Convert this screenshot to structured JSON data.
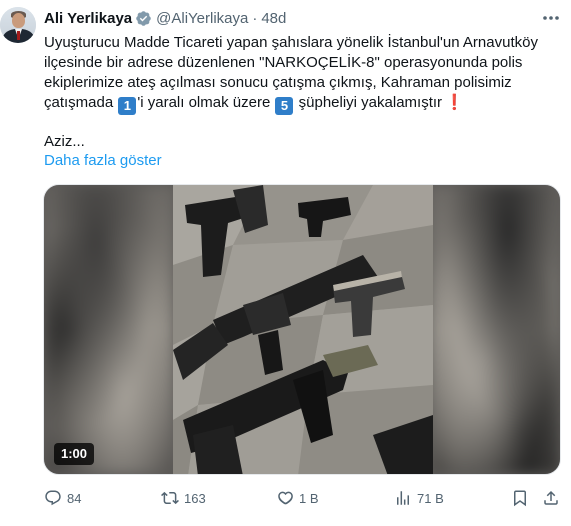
{
  "tweet": {
    "author": {
      "name": "Ali Yerlikaya",
      "handle": "@AliYerlikaya",
      "verified_badge_color": "#829aab"
    },
    "separator": "·",
    "time": "48d",
    "text_lines": {
      "l1": "Uyuşturucu Madde Ticareti yapan şahıslara yönelik İstanbul'un Arnavutköy",
      "l2": "ilçesinde bir adrese düzenlenen \"NARKOÇELİK-8\" operasyonunda polis",
      "l3": "ekiplerimize ateş açılması sonucu çatışma çıkmış, Kahraman polisimiz",
      "l4_a": "çatışmada",
      "keycap_1": "1",
      "l4_b": "'i yaralı olmak üzere",
      "keycap_5": "5",
      "l4_c": "şüpheliyi yakalamıştır",
      "exclamation": "❗"
    },
    "truncated_text": "Aziz...",
    "show_more_label": "Daha fazla göster",
    "link_color": "#1d9bf0",
    "media": {
      "duration": "1:00"
    },
    "actions": {
      "replies": "84",
      "reposts": "163",
      "likes": "1 B",
      "views": "71 B"
    },
    "icons": {
      "more": "more-dots-icon",
      "reply": "reply-icon",
      "repost": "repost-icon",
      "like": "heart-icon",
      "views": "analytics-icon",
      "bookmark": "bookmark-icon",
      "share": "share-icon"
    }
  }
}
